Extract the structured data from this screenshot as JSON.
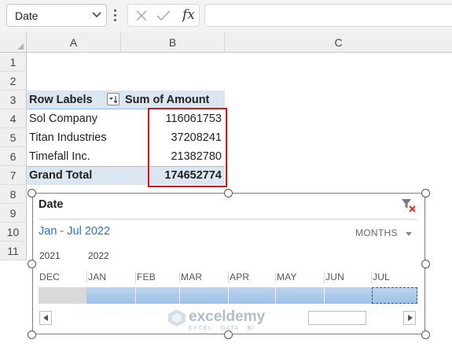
{
  "formula_bar": {
    "name_box": "Date",
    "fx_label": "fx",
    "formula_value": ""
  },
  "grid": {
    "columns": [
      "A",
      "B",
      "C"
    ],
    "rows": [
      "1",
      "2",
      "3",
      "4",
      "5",
      "6",
      "7",
      "8",
      "9",
      "10",
      "11"
    ]
  },
  "pivot": {
    "header_row_labels": "Row Labels",
    "header_sum": "Sum of Amount",
    "rows": [
      {
        "label": "Sol Company",
        "value": "116061753"
      },
      {
        "label": "Titan Industries",
        "value": "37208241"
      },
      {
        "label": "Timefall Inc.",
        "value": "21382780"
      }
    ],
    "total_label": "Grand Total",
    "total_value": "174652774",
    "highlight_color": "#d11a1a"
  },
  "timeline": {
    "title": "Date",
    "range": "Jan - Jul 2022",
    "level": "MONTHS",
    "years": [
      "2021",
      "2022"
    ],
    "months": [
      "DEC",
      "JAN",
      "FEB",
      "MAR",
      "APR",
      "MAY",
      "JUN",
      "JUL"
    ],
    "selection_color": "#9cc0e6"
  },
  "watermark": {
    "name": "exceldemy",
    "tagline": "EXCEL · DATA · BI"
  }
}
